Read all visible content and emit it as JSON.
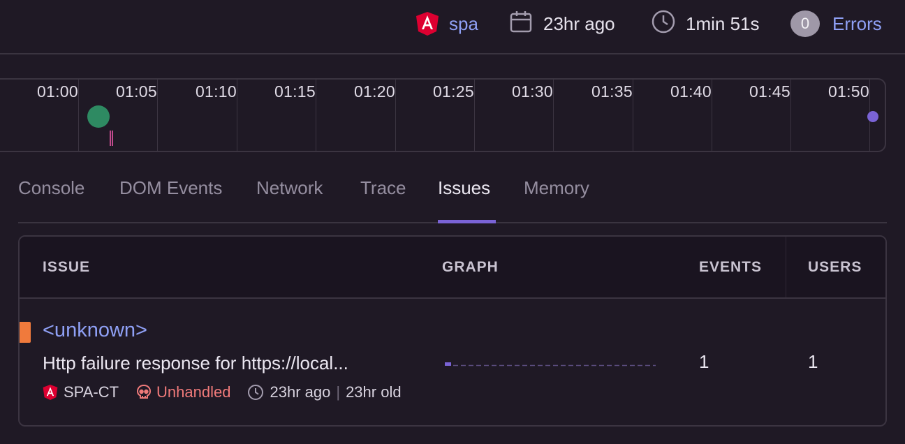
{
  "header": {
    "project": "spa",
    "date": "23hr ago",
    "duration": "1min 51s",
    "errors_count": "0",
    "errors_label": "Errors"
  },
  "timeline": {
    "ticks": [
      "01:00",
      "01:05",
      "01:10",
      "01:15",
      "01:20",
      "01:25",
      "01:30",
      "01:35",
      "01:40",
      "01:45",
      "01:50"
    ]
  },
  "tabs": [
    "Console",
    "DOM Events",
    "Network",
    "Trace",
    "Issues",
    "Memory"
  ],
  "active_tab": "Issues",
  "table": {
    "headers": {
      "issue": "ISSUE",
      "graph": "GRAPH",
      "events": "EVENTS",
      "users": "USERS"
    },
    "rows": [
      {
        "title": "<unknown>",
        "message": "Http failure response for https://local...",
        "project": "SPA-CT",
        "status": "Unhandled",
        "first_seen": "23hr ago",
        "separator": "|",
        "age": "23hr old",
        "events": "1",
        "users": "1"
      }
    ]
  },
  "colors": {
    "background": "#1f1925",
    "link": "#8fa0f5",
    "accent": "#7a63d6",
    "unhandled": "#f07a7a",
    "severity": "#f07a3c",
    "angular": "#dd0031",
    "marker": "#2e8a62"
  },
  "icons": [
    "angular-icon",
    "calendar-icon",
    "clock-icon",
    "skull-icon"
  ]
}
